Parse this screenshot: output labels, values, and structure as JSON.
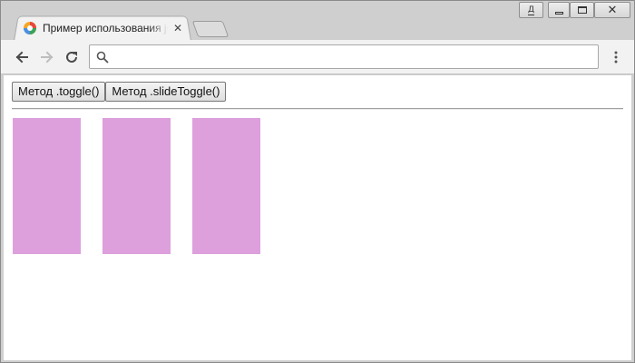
{
  "browser": {
    "tab": {
      "title": "Пример использования jQuery",
      "close_glyph": "✕"
    },
    "window_controls": {
      "user_letter": "Д",
      "close_glyph": "✕"
    },
    "omnibox": {
      "value": "",
      "placeholder": ""
    },
    "icons": {
      "back": "arrow-left-icon",
      "forward": "arrow-right-icon",
      "reload": "reload-icon",
      "search": "search-icon",
      "menu": "kebab-menu-icon"
    }
  },
  "page": {
    "buttons": {
      "toggle": "Метод .toggle()",
      "slide_toggle": "Метод .slideToggle()"
    },
    "block_color": "#dda0dd",
    "block_count": 3
  }
}
